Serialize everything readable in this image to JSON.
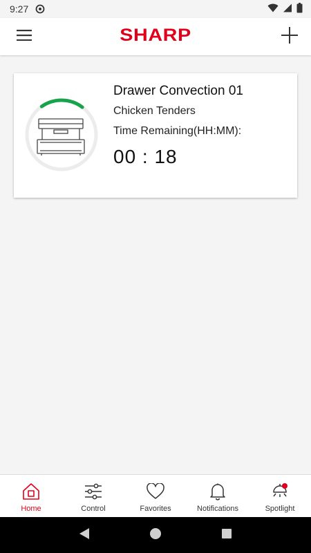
{
  "status_bar": {
    "time": "9:27",
    "icons": [
      "sync-icon",
      "wifi-icon",
      "signal-icon",
      "battery-icon"
    ]
  },
  "app_bar": {
    "logo_text": "SHARP",
    "brand_color": "#e0001b",
    "menu_icon": "hamburger-menu-icon",
    "add_icon": "plus-icon"
  },
  "device_card": {
    "device_name": "Drawer Convection 01",
    "recipe": "Chicken Tenders",
    "time_label": "Time Remaining(HH:MM):",
    "time_value": "00 : 18",
    "progress_color": "#17a34a",
    "progress_fraction": 0.2,
    "icon": "drawer-oven-icon"
  },
  "bottom_nav": {
    "active_color": "#e0001b",
    "items": [
      {
        "label": "Home",
        "icon": "home-icon",
        "active": true
      },
      {
        "label": "Control",
        "icon": "sliders-icon",
        "active": false
      },
      {
        "label": "Favorites",
        "icon": "heart-icon",
        "active": false
      },
      {
        "label": "Notifications",
        "icon": "bell-icon",
        "active": false
      },
      {
        "label": "Spotlight",
        "icon": "spotlight-lamp-icon",
        "active": false,
        "badge": true
      }
    ]
  },
  "system_nav": {
    "buttons": [
      "back-icon",
      "home-circle-icon",
      "recents-icon"
    ]
  }
}
